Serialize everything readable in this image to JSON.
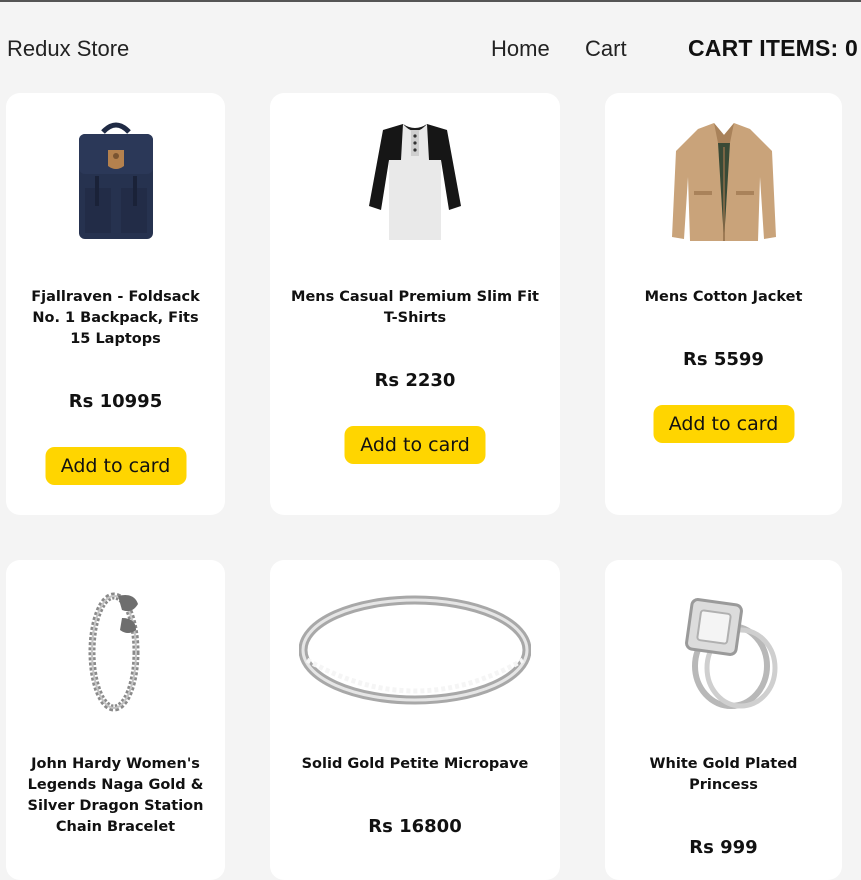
{
  "navbar": {
    "brand": "Redux Store",
    "links": [
      "Home",
      "Cart"
    ],
    "cart_label": "CART ITEMS: 0"
  },
  "products": [
    {
      "title": "Fjallraven - Foldsack No. 1 Backpack, Fits 15 Laptops",
      "price": "Rs 10995",
      "button": "Add to card",
      "image": "backpack"
    },
    {
      "title": "Mens Casual Premium Slim Fit T-Shirts",
      "price": "Rs 2230",
      "button": "Add to card",
      "image": "t-shirt"
    },
    {
      "title": "Mens Cotton Jacket",
      "price": "Rs 5599",
      "button": "Add to card",
      "image": "jacket"
    },
    {
      "title": "John Hardy Women's Legends Naga Gold & Silver Dragon Station Chain Bracelet",
      "price": "",
      "button": "",
      "image": "bracelet"
    },
    {
      "title": "Solid Gold Petite Micropave",
      "price": "Rs 16800",
      "button": "",
      "image": "ring"
    },
    {
      "title": "White Gold Plated Princess",
      "price": "Rs 999",
      "button": "",
      "image": "engagement-ring"
    }
  ],
  "colors": {
    "page_background": "#f4f4f4",
    "card_background": "#ffffff",
    "button": "#ffd500"
  }
}
